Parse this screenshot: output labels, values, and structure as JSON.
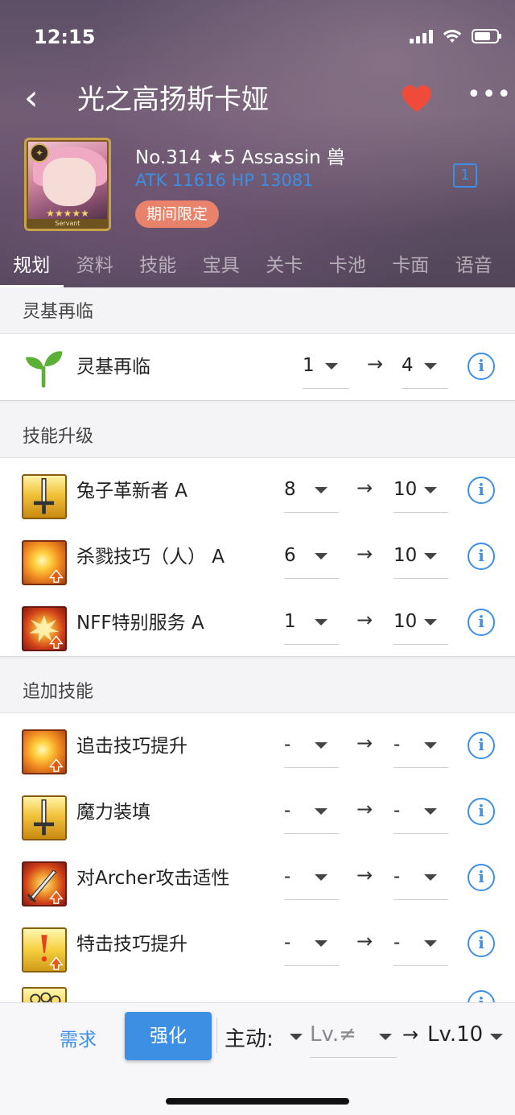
{
  "status_bar": {
    "time": "12:15"
  },
  "nav": {
    "back_icon": "‹",
    "title": "光之高扬斯卡娅",
    "more_icon": "•••"
  },
  "servant": {
    "line1": "No.314 ★5  Assassin 兽",
    "line2": "ATK 11616  HP 13081",
    "badge": "期间限定",
    "card_stars": "★★★★★",
    "card_label": "Servant",
    "num_badge": "1"
  },
  "tabs": [
    "规划",
    "资料",
    "技能",
    "宝具",
    "关卡",
    "卡池",
    "卡面",
    "语音"
  ],
  "ascension": {
    "section_title": "灵基再临",
    "rows": [
      {
        "icon": "sprout-icon",
        "label": "灵基再临",
        "from": "1",
        "to": "4"
      }
    ]
  },
  "skills": {
    "section_title": "技能升级",
    "rows": [
      {
        "icon": "sword-skill-icon",
        "label": "兔子革新者 A",
        "from": "8",
        "to": "10"
      },
      {
        "icon": "burst-skill-icon",
        "label": "杀戮技巧（人） A",
        "from": "6",
        "to": "10"
      },
      {
        "icon": "explosion-skill-icon",
        "label": "NFF特别服务 A",
        "from": "1",
        "to": "10"
      }
    ]
  },
  "append_skills": {
    "section_title": "追加技能",
    "rows": [
      {
        "icon": "burst-skill-icon",
        "label": "追击技巧提升",
        "from": "-",
        "to": "-"
      },
      {
        "icon": "sword-skill-icon",
        "label": "魔力装填",
        "from": "-",
        "to": "-"
      },
      {
        "icon": "archer-sword-icon",
        "label": "对Archer攻击适性",
        "from": "-",
        "to": "-"
      },
      {
        "icon": "critical-skill-icon",
        "label": "特击技巧提升",
        "from": "-",
        "to": "-"
      }
    ]
  },
  "bottom_bar": {
    "need_label": "需求",
    "enhance_label": "强化",
    "active_label": "主动:",
    "level_from": "Lv.≠",
    "arrow": "→",
    "level_to": "Lv.10"
  },
  "colors": {
    "accent": "#3d8fe3",
    "heart": "#f04a3a",
    "badge": "#e8826a"
  }
}
